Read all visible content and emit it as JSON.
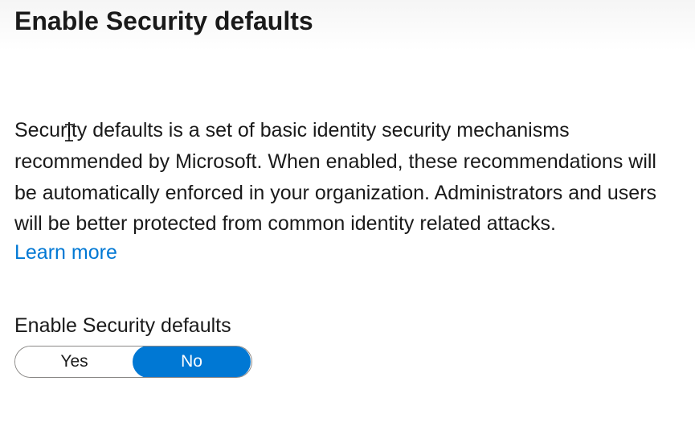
{
  "header": {
    "title": "Enable Security defaults"
  },
  "content": {
    "description": "Security defaults is a set of basic identity security mechanisms recommended by Microsoft. When enabled, these recommendations will be automatically enforced in your organization. Administrators and users will be better protected from common identity related attacks.",
    "learn_more_label": "Learn more"
  },
  "toggle": {
    "label": "Enable Security defaults",
    "options": {
      "yes": "Yes",
      "no": "No"
    },
    "selected": "no"
  }
}
